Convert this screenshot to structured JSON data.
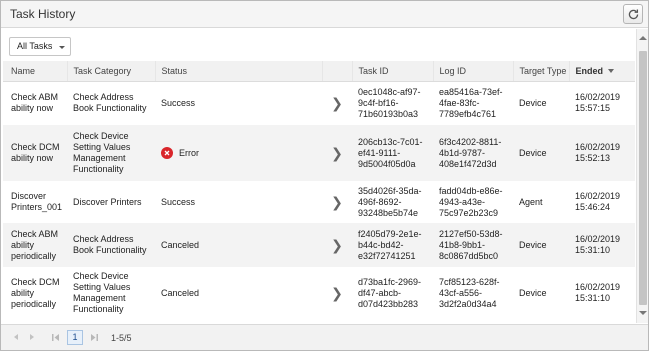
{
  "window": {
    "title": "Task History"
  },
  "toolbar": {
    "filter_value": "All Tasks"
  },
  "columns": [
    "Name",
    "Task Category",
    "Status",
    "Task ID",
    "Log ID",
    "Target Type",
    "Ended"
  ],
  "rows": [
    {
      "name": "Check ABM ability now",
      "category": "Check Address Book Functionality",
      "status": "Success",
      "task_id": "0ec1048c-af97-9c4f-bf16-71b60193b0a3",
      "log_id": "ea85416a-73ef-4fae-83fc-7789efb4c761",
      "target": "Device",
      "ended": "16/02/2019 15:57:15"
    },
    {
      "name": "Check DCM ability now",
      "category": "Check Device Setting Values Management Functionality",
      "status": "Error",
      "task_id": "206cb13c-7c01-ef41-9111-9d5004f05d0a",
      "log_id": "6f3c4202-8811-4b1d-9787-408e1f472d3d",
      "target": "Device",
      "ended": "16/02/2019 15:52:13"
    },
    {
      "name": "Discover Printers_001",
      "category": "Discover Printers",
      "status": "Success",
      "task_id": "35d4026f-35da-496f-8692-93248be5b74e",
      "log_id": "fadd04db-e86e-4943-a43e-75c97e2b23c9",
      "target": "Agent",
      "ended": "16/02/2019 15:46:24"
    },
    {
      "name": "Check ABM ability periodically",
      "category": "Check Address Book Functionality",
      "status": "Canceled",
      "task_id": "f2405d79-2e1e-b44c-bd42-e32f72741251",
      "log_id": "2127ef50-53d8-41b8-9bb1-8c0867dd5bc0",
      "target": "Device",
      "ended": "16/02/2019 15:31:10"
    },
    {
      "name": "Check DCM ability periodically",
      "category": "Check Device Setting Values Management Functionality",
      "status": "Canceled",
      "task_id": "d73ba1fc-2969-df47-abcb-d07d423bb283",
      "log_id": "7cf85123-628f-43cf-a556-3d2f2a0d34a4",
      "target": "Device",
      "ended": "16/02/2019 15:31:10"
    }
  ],
  "pagination": {
    "current_page": "1",
    "range": "1-5/5"
  },
  "colors": {
    "error": "#d9252a",
    "header_bg": "#f1f1f1",
    "stripe_bg": "#f3f3f3"
  },
  "icons": {
    "refresh": "refresh-icon",
    "error": "error-icon",
    "row_detail": "chevron-right-icon"
  }
}
